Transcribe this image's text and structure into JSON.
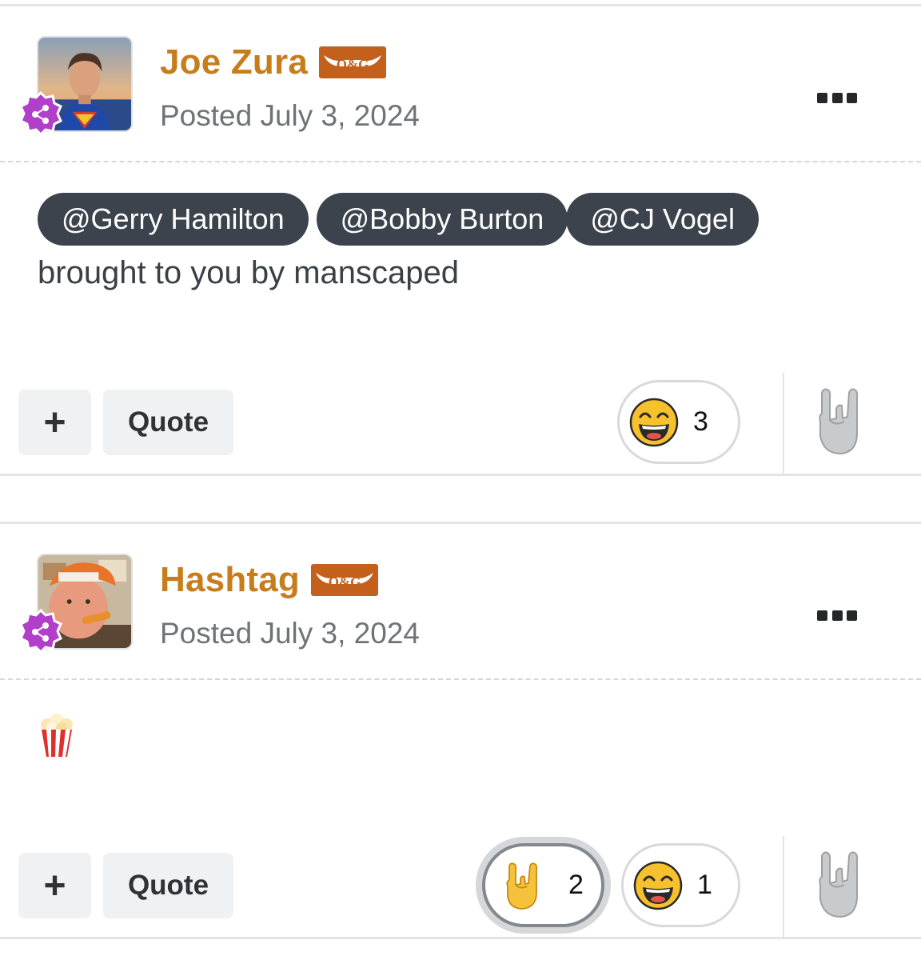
{
  "posts": [
    {
      "author": "Joe Zura",
      "badge_text": "O&G",
      "posted": "Posted July 3, 2024",
      "mentions": [
        "@Gerry Hamilton",
        "@Bobby Burton",
        "@CJ Vogel"
      ],
      "body": "brought to you by manscaped",
      "actions": {
        "plus": "+",
        "quote": "Quote"
      },
      "reactions": [
        {
          "icon": "laughing-face-icon",
          "count": "3",
          "active": false
        }
      ]
    },
    {
      "author": "Hashtag",
      "badge_text": "O&G",
      "posted": "Posted July 3, 2024",
      "body_icon": "popcorn-icon",
      "actions": {
        "plus": "+",
        "quote": "Quote"
      },
      "reactions": [
        {
          "icon": "rock-on-hand-icon",
          "count": "2",
          "active": true
        },
        {
          "icon": "laughing-face-icon",
          "count": "1",
          "active": false
        }
      ]
    }
  ],
  "colors": {
    "author": "#c77d1c",
    "og_badge": "#c2601c",
    "group_badge": "#b13fc9",
    "mention_bg": "#3c434d"
  }
}
